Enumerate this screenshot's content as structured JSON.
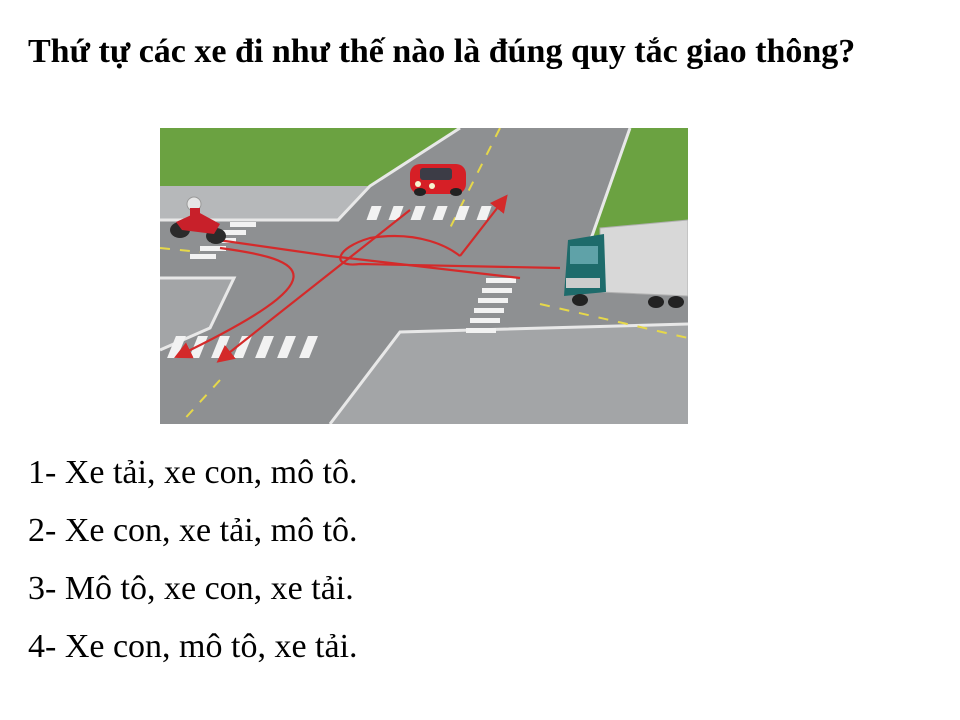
{
  "question": {
    "text": "Thứ tự các xe đi như thế nào là đúng quy tắc giao thông?"
  },
  "scene": {
    "vehicles": [
      {
        "kind": "motorcycle",
        "color": "#c8202a"
      },
      {
        "kind": "car",
        "color": "#d61f26"
      },
      {
        "kind": "truck",
        "color": "#1e6b6b"
      }
    ],
    "route_color": "#d42a2a",
    "road_color": "#8e9092",
    "grass_color": "#6ba241",
    "lane_marking_color": "#e6d84a"
  },
  "answers": [
    {
      "text": "1- Xe tải, xe con, mô tô."
    },
    {
      "text": "2- Xe con, xe tải, mô tô."
    },
    {
      "text": "3- Mô tô, xe con, xe tải."
    },
    {
      "text": "4- Xe con, mô tô, xe tải."
    }
  ]
}
